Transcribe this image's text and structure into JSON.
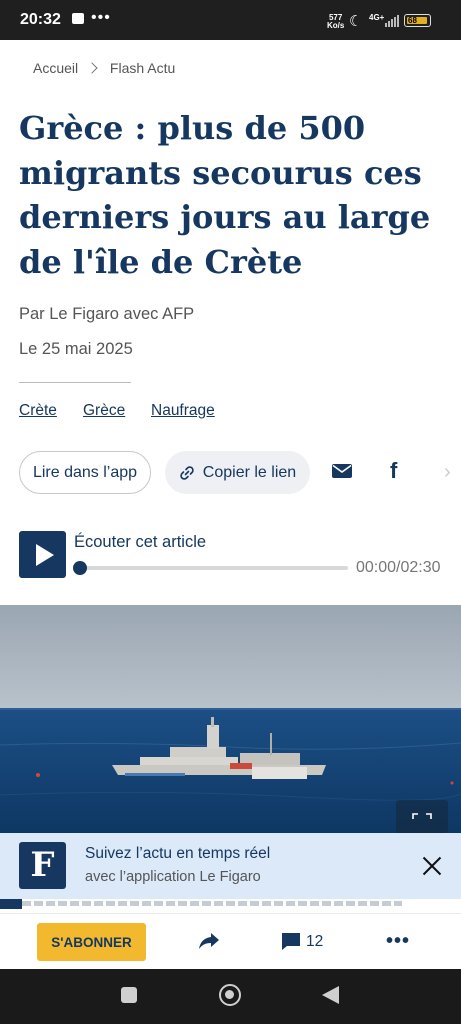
{
  "status_bar": {
    "time": "20:32",
    "dots": "•••",
    "speed_value": "577",
    "speed_unit": "Ko/s",
    "network": "4G+",
    "battery": "68",
    "battery_color": "#e0b020"
  },
  "breadcrumb": {
    "home": "Accueil",
    "section": "Flash Actu"
  },
  "article": {
    "title": "Grèce : plus de 500 migrants secourus ces derniers jours au large de l'île de Crète",
    "byline": "Par Le Figaro avec AFP",
    "date": "Le 25 mai 2025",
    "tags": [
      "Crète",
      "Grèce",
      "Naufrage"
    ]
  },
  "actions": {
    "read_in_app": "Lire dans l’app",
    "copy_link": "Copier le lien",
    "mail_icon": "mail-icon",
    "facebook_icon": "f",
    "more_share_icon": "›"
  },
  "audio": {
    "label": "Écouter cet article",
    "time": "00:00/02:30",
    "progress": 0
  },
  "app_banner": {
    "logo": "F",
    "title": "Suivez l’actu en temps réel",
    "subtitle": "avec l’application Le Figaro"
  },
  "bottom_bar": {
    "subscribe": "S'ABONNER",
    "comments": "12"
  },
  "colors": {
    "brand_navy": "#163860",
    "subscribe_yellow": "#f2b92f",
    "banner_bg": "#dbe9f9"
  }
}
